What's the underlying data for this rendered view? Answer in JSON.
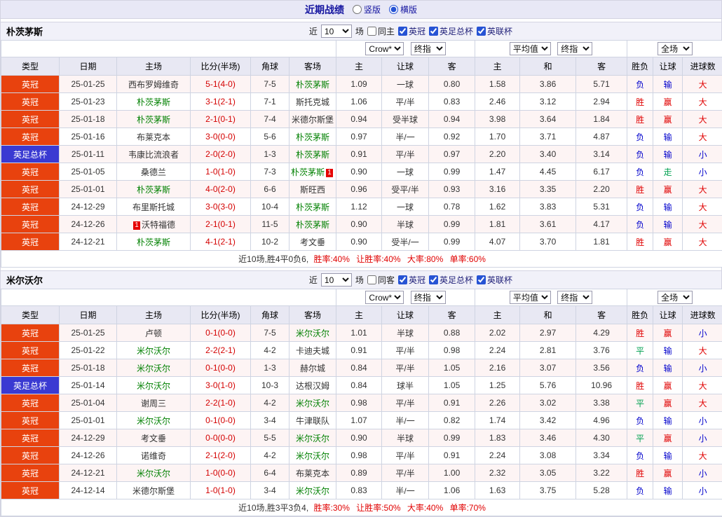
{
  "titlebar": {
    "title": "近期战绩",
    "view_options": [
      {
        "label": "竖版",
        "selected": false
      },
      {
        "label": "横版",
        "selected": true
      }
    ]
  },
  "headers": {
    "left": [
      "类型",
      "日期",
      "主场",
      "比分(半场)",
      "角球",
      "客场"
    ],
    "odds": [
      "主",
      "让球",
      "客"
    ],
    "avg": [
      "主",
      "和",
      "客"
    ],
    "result": [
      "胜负",
      "让球",
      "进球数"
    ],
    "selects": {
      "bookmaker": "Crow*",
      "final_a": "终指",
      "average": "平均值",
      "final_b": "终指",
      "scope": "全场"
    }
  },
  "colors": {
    "league_badge": "#e8420e",
    "cup_badge": "#3a3ad2",
    "win": "#e00000",
    "loss": "#0000cc",
    "draw_push": "#00a050",
    "focal_team": "#008000",
    "score": "#d40000",
    "accent": "#2653d4",
    "title": "#1515a0"
  },
  "sections": [
    {
      "team": "朴茨茅斯",
      "filters": {
        "near": "近",
        "count": "10",
        "games": "场",
        "same": {
          "label": "同主",
          "checked": false
        },
        "competitions": [
          {
            "label": "英冠",
            "checked": true
          },
          {
            "label": "英足总杯",
            "checked": true
          },
          {
            "label": "英联杯",
            "checked": true
          }
        ]
      },
      "rows": [
        {
          "league": "英冠",
          "cup": false,
          "date": "25-01-25",
          "home": {
            "name": "西布罗姆维奇",
            "green": false
          },
          "score": "5-1(4-0)",
          "corners": "7-5",
          "away": {
            "name": "朴茨茅斯",
            "green": true
          },
          "odds": [
            "1.09",
            "一球",
            "0.80"
          ],
          "avg": [
            "1.58",
            "3.86",
            "5.71"
          ],
          "results": [
            [
              "负",
              "blue"
            ],
            [
              "输",
              "blue"
            ],
            [
              "大",
              "red"
            ]
          ]
        },
        {
          "league": "英冠",
          "cup": false,
          "date": "25-01-23",
          "home": {
            "name": "朴茨茅斯",
            "green": true
          },
          "score": "3-1(2-1)",
          "corners": "7-1",
          "away": {
            "name": "斯托克城",
            "green": false
          },
          "odds": [
            "1.06",
            "平/半",
            "0.83"
          ],
          "avg": [
            "2.46",
            "3.12",
            "2.94"
          ],
          "results": [
            [
              "胜",
              "red"
            ],
            [
              "赢",
              "red"
            ],
            [
              "大",
              "red"
            ]
          ]
        },
        {
          "league": "英冠",
          "cup": false,
          "date": "25-01-18",
          "home": {
            "name": "朴茨茅斯",
            "green": true
          },
          "score": "2-1(0-1)",
          "corners": "7-4",
          "away": {
            "name": "米德尔斯堡",
            "green": false
          },
          "odds": [
            "0.94",
            "受半球",
            "0.94"
          ],
          "avg": [
            "3.98",
            "3.64",
            "1.84"
          ],
          "results": [
            [
              "胜",
              "red"
            ],
            [
              "赢",
              "red"
            ],
            [
              "大",
              "red"
            ]
          ]
        },
        {
          "league": "英冠",
          "cup": false,
          "date": "25-01-16",
          "home": {
            "name": "布莱克本",
            "green": false
          },
          "score": "3-0(0-0)",
          "corners": "5-6",
          "away": {
            "name": "朴茨茅斯",
            "green": true
          },
          "odds": [
            "0.97",
            "半/一",
            "0.92"
          ],
          "avg": [
            "1.70",
            "3.71",
            "4.87"
          ],
          "results": [
            [
              "负",
              "blue"
            ],
            [
              "输",
              "blue"
            ],
            [
              "大",
              "red"
            ]
          ]
        },
        {
          "league": "英足总杯",
          "cup": true,
          "date": "25-01-11",
          "home": {
            "name": "韦康比流浪者",
            "green": false
          },
          "score": "2-0(2-0)",
          "corners": "1-3",
          "away": {
            "name": "朴茨茅斯",
            "green": true
          },
          "odds": [
            "0.91",
            "平/半",
            "0.97"
          ],
          "avg": [
            "2.20",
            "3.40",
            "3.14"
          ],
          "results": [
            [
              "负",
              "blue"
            ],
            [
              "输",
              "blue"
            ],
            [
              "小",
              "blue"
            ]
          ]
        },
        {
          "league": "英冠",
          "cup": false,
          "date": "25-01-05",
          "home": {
            "name": "桑德兰",
            "green": false
          },
          "score": "1-0(1-0)",
          "corners": "7-3",
          "away": {
            "name": "朴茨茅斯",
            "green": true,
            "card": {
              "pos": "after",
              "num": "1"
            }
          },
          "odds": [
            "0.90",
            "一球",
            "0.99"
          ],
          "avg": [
            "1.47",
            "4.45",
            "6.17"
          ],
          "results": [
            [
              "负",
              "blue"
            ],
            [
              "走",
              "green"
            ],
            [
              "小",
              "blue"
            ]
          ]
        },
        {
          "league": "英冠",
          "cup": false,
          "date": "25-01-01",
          "home": {
            "name": "朴茨茅斯",
            "green": true
          },
          "score": "4-0(2-0)",
          "corners": "6-6",
          "away": {
            "name": "斯旺西",
            "green": false
          },
          "odds": [
            "0.96",
            "受平/半",
            "0.93"
          ],
          "avg": [
            "3.16",
            "3.35",
            "2.20"
          ],
          "results": [
            [
              "胜",
              "red"
            ],
            [
              "赢",
              "red"
            ],
            [
              "大",
              "red"
            ]
          ]
        },
        {
          "league": "英冠",
          "cup": false,
          "date": "24-12-29",
          "home": {
            "name": "布里斯托城",
            "green": false
          },
          "score": "3-0(3-0)",
          "corners": "10-4",
          "away": {
            "name": "朴茨茅斯",
            "green": true
          },
          "odds": [
            "1.12",
            "一球",
            "0.78"
          ],
          "avg": [
            "1.62",
            "3.83",
            "5.31"
          ],
          "results": [
            [
              "负",
              "blue"
            ],
            [
              "输",
              "blue"
            ],
            [
              "大",
              "red"
            ]
          ]
        },
        {
          "league": "英冠",
          "cup": false,
          "date": "24-12-26",
          "home": {
            "name": "沃特福德",
            "green": false,
            "card": {
              "pos": "before",
              "num": "1"
            }
          },
          "score": "2-1(0-1)",
          "corners": "11-5",
          "away": {
            "name": "朴茨茅斯",
            "green": true
          },
          "odds": [
            "0.90",
            "半球",
            "0.99"
          ],
          "avg": [
            "1.81",
            "3.61",
            "4.17"
          ],
          "results": [
            [
              "负",
              "blue"
            ],
            [
              "输",
              "blue"
            ],
            [
              "大",
              "red"
            ]
          ]
        },
        {
          "league": "英冠",
          "cup": false,
          "date": "24-12-21",
          "home": {
            "name": "朴茨茅斯",
            "green": true
          },
          "score": "4-1(2-1)",
          "corners": "10-2",
          "away": {
            "name": "考文垂",
            "green": false
          },
          "odds": [
            "0.90",
            "受半/一",
            "0.99"
          ],
          "avg": [
            "4.07",
            "3.70",
            "1.81"
          ],
          "results": [
            [
              "胜",
              "red"
            ],
            [
              "赢",
              "red"
            ],
            [
              "大",
              "red"
            ]
          ]
        }
      ],
      "summary": {
        "intro": "近10场,胜4平0负6,",
        "stats": "胜率:40% 让胜率:40% 大率:80% 单率:60%"
      }
    },
    {
      "team": "米尔沃尔",
      "filters": {
        "near": "近",
        "count": "10",
        "games": "场",
        "same": {
          "label": "同客",
          "checked": false
        },
        "competitions": [
          {
            "label": "英冠",
            "checked": true
          },
          {
            "label": "英足总杯",
            "checked": true
          },
          {
            "label": "英联杯",
            "checked": true
          }
        ]
      },
      "rows": [
        {
          "league": "英冠",
          "cup": false,
          "date": "25-01-25",
          "home": {
            "name": "卢顿",
            "green": false
          },
          "score": "0-1(0-0)",
          "corners": "7-5",
          "away": {
            "name": "米尔沃尔",
            "green": true
          },
          "odds": [
            "1.01",
            "半球",
            "0.88"
          ],
          "avg": [
            "2.02",
            "2.97",
            "4.29"
          ],
          "results": [
            [
              "胜",
              "red"
            ],
            [
              "赢",
              "red"
            ],
            [
              "小",
              "blue"
            ]
          ]
        },
        {
          "league": "英冠",
          "cup": false,
          "date": "25-01-22",
          "home": {
            "name": "米尔沃尔",
            "green": true
          },
          "score": "2-2(2-1)",
          "corners": "4-2",
          "away": {
            "name": "卡迪夫城",
            "green": false
          },
          "odds": [
            "0.91",
            "平/半",
            "0.98"
          ],
          "avg": [
            "2.24",
            "2.81",
            "3.76"
          ],
          "results": [
            [
              "平",
              "green"
            ],
            [
              "输",
              "blue"
            ],
            [
              "大",
              "red"
            ]
          ]
        },
        {
          "league": "英冠",
          "cup": false,
          "date": "25-01-18",
          "home": {
            "name": "米尔沃尔",
            "green": true
          },
          "score": "0-1(0-0)",
          "corners": "1-3",
          "away": {
            "name": "赫尔城",
            "green": false
          },
          "odds": [
            "0.84",
            "平/半",
            "1.05"
          ],
          "avg": [
            "2.16",
            "3.07",
            "3.56"
          ],
          "results": [
            [
              "负",
              "blue"
            ],
            [
              "输",
              "blue"
            ],
            [
              "小",
              "blue"
            ]
          ]
        },
        {
          "league": "英足总杯",
          "cup": true,
          "date": "25-01-14",
          "home": {
            "name": "米尔沃尔",
            "green": true
          },
          "score": "3-0(1-0)",
          "corners": "10-3",
          "away": {
            "name": "达根汉姆",
            "green": false
          },
          "odds": [
            "0.84",
            "球半",
            "1.05"
          ],
          "avg": [
            "1.25",
            "5.76",
            "10.96"
          ],
          "results": [
            [
              "胜",
              "red"
            ],
            [
              "赢",
              "red"
            ],
            [
              "大",
              "red"
            ]
          ]
        },
        {
          "league": "英冠",
          "cup": false,
          "date": "25-01-04",
          "home": {
            "name": "谢周三",
            "green": false
          },
          "score": "2-2(1-0)",
          "corners": "4-2",
          "away": {
            "name": "米尔沃尔",
            "green": true
          },
          "odds": [
            "0.98",
            "平/半",
            "0.91"
          ],
          "avg": [
            "2.26",
            "3.02",
            "3.38"
          ],
          "results": [
            [
              "平",
              "green"
            ],
            [
              "赢",
              "red"
            ],
            [
              "大",
              "red"
            ]
          ]
        },
        {
          "league": "英冠",
          "cup": false,
          "date": "25-01-01",
          "home": {
            "name": "米尔沃尔",
            "green": true
          },
          "score": "0-1(0-0)",
          "corners": "3-4",
          "away": {
            "name": "牛津联队",
            "green": false
          },
          "odds": [
            "1.07",
            "半/一",
            "0.82"
          ],
          "avg": [
            "1.74",
            "3.42",
            "4.96"
          ],
          "results": [
            [
              "负",
              "blue"
            ],
            [
              "输",
              "blue"
            ],
            [
              "小",
              "blue"
            ]
          ]
        },
        {
          "league": "英冠",
          "cup": false,
          "date": "24-12-29",
          "home": {
            "name": "考文垂",
            "green": false
          },
          "score": "0-0(0-0)",
          "corners": "5-5",
          "away": {
            "name": "米尔沃尔",
            "green": true
          },
          "odds": [
            "0.90",
            "半球",
            "0.99"
          ],
          "avg": [
            "1.83",
            "3.46",
            "4.30"
          ],
          "results": [
            [
              "平",
              "green"
            ],
            [
              "赢",
              "red"
            ],
            [
              "小",
              "blue"
            ]
          ]
        },
        {
          "league": "英冠",
          "cup": false,
          "date": "24-12-26",
          "home": {
            "name": "诺维奇",
            "green": false
          },
          "score": "2-1(2-0)",
          "corners": "4-2",
          "away": {
            "name": "米尔沃尔",
            "green": true
          },
          "odds": [
            "0.98",
            "平/半",
            "0.91"
          ],
          "avg": [
            "2.24",
            "3.08",
            "3.34"
          ],
          "results": [
            [
              "负",
              "blue"
            ],
            [
              "输",
              "blue"
            ],
            [
              "大",
              "red"
            ]
          ]
        },
        {
          "league": "英冠",
          "cup": false,
          "date": "24-12-21",
          "home": {
            "name": "米尔沃尔",
            "green": true
          },
          "score": "1-0(0-0)",
          "corners": "6-4",
          "away": {
            "name": "布莱克本",
            "green": false
          },
          "odds": [
            "0.89",
            "平/半",
            "1.00"
          ],
          "avg": [
            "2.32",
            "3.05",
            "3.22"
          ],
          "results": [
            [
              "胜",
              "red"
            ],
            [
              "赢",
              "red"
            ],
            [
              "小",
              "blue"
            ]
          ]
        },
        {
          "league": "英冠",
          "cup": false,
          "date": "24-12-14",
          "home": {
            "name": "米德尔斯堡",
            "green": false
          },
          "score": "1-0(1-0)",
          "corners": "3-4",
          "away": {
            "name": "米尔沃尔",
            "green": true
          },
          "odds": [
            "0.83",
            "半/一",
            "1.06"
          ],
          "avg": [
            "1.63",
            "3.75",
            "5.28"
          ],
          "results": [
            [
              "负",
              "blue"
            ],
            [
              "输",
              "blue"
            ],
            [
              "小",
              "blue"
            ]
          ]
        }
      ],
      "summary": {
        "intro": "近10场,胜3平3负4,",
        "stats": "胜率:30% 让胜率:50% 大率:40% 单率:70%"
      }
    }
  ]
}
